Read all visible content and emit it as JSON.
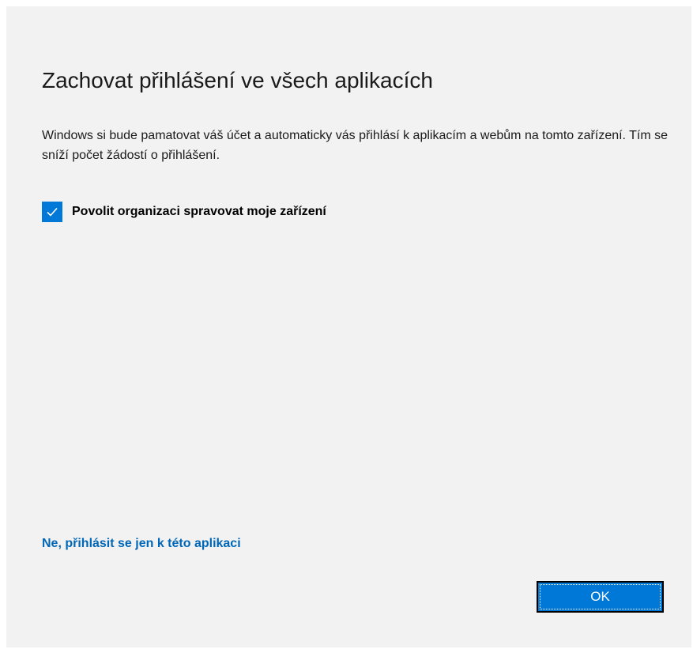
{
  "dialog": {
    "title": "Zachovat přihlášení ve všech aplikacích",
    "description": "Windows si bude pamatovat váš účet a automaticky vás přihlásí k aplikacím a webům na tomto zařízení. Tím se sníží počet žádostí o přihlášení.",
    "checkbox": {
      "label": "Povolit organizaci spravovat moje zařízení",
      "checked": true,
      "icon": "checkmark-icon"
    },
    "link_text": "Ne, přihlásit se jen k této aplikaci",
    "ok_label": "OK"
  },
  "colors": {
    "accent": "#0078d7",
    "link": "#0067b8",
    "background": "#f2f2f2"
  }
}
